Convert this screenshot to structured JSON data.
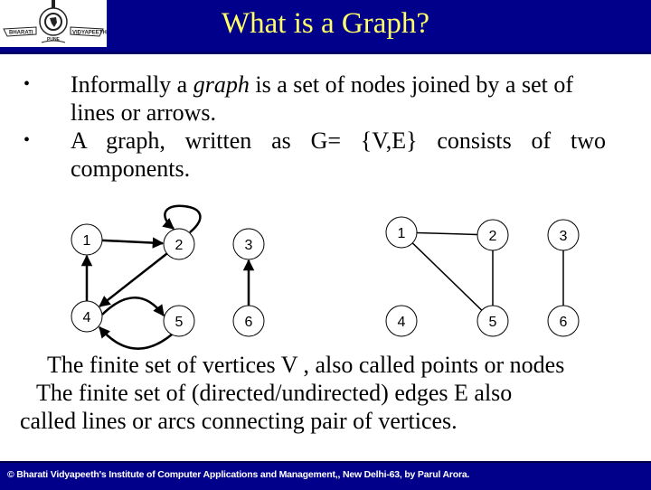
{
  "header": {
    "title": "What is a Graph?",
    "logo": {
      "icon": "institution-logo-icon",
      "left_text": "BHARATI",
      "right_text": "VIDYAPEETH",
      "bottom_text": "PUNE"
    },
    "colors": {
      "background": "#00008b",
      "title": "#ffff66"
    }
  },
  "bullets": [
    {
      "pre": "Informally a ",
      "em": "graph",
      "post": " is a set of nodes joined by a set of lines or arrows."
    },
    {
      "text": "A graph, written as G= {V,E} consists of two components."
    }
  ],
  "directed_graph": {
    "nodes": [
      {
        "id": "1",
        "label": "1"
      },
      {
        "id": "2",
        "label": "2"
      },
      {
        "id": "3",
        "label": "3"
      },
      {
        "id": "4",
        "label": "4"
      },
      {
        "id": "5",
        "label": "5"
      },
      {
        "id": "6",
        "label": "6"
      }
    ],
    "edges": [
      {
        "from": "1",
        "to": "2"
      },
      {
        "from": "2",
        "to": "2"
      },
      {
        "from": "2",
        "to": "4"
      },
      {
        "from": "4",
        "to": "1"
      },
      {
        "from": "4",
        "to": "5"
      },
      {
        "from": "5",
        "to": "4"
      },
      {
        "from": "6",
        "to": "3"
      }
    ]
  },
  "undirected_graph": {
    "nodes": [
      {
        "id": "1",
        "label": "1"
      },
      {
        "id": "2",
        "label": "2"
      },
      {
        "id": "3",
        "label": "3"
      },
      {
        "id": "4",
        "label": "4"
      },
      {
        "id": "5",
        "label": "5"
      },
      {
        "id": "6",
        "label": "6"
      }
    ],
    "edges": [
      {
        "from": "1",
        "to": "2"
      },
      {
        "from": "1",
        "to": "5"
      },
      {
        "from": "2",
        "to": "5"
      },
      {
        "from": "3",
        "to": "6"
      }
    ]
  },
  "description": [
    "The finite set of vertices V , also called points or nodes",
    "The finite set of (directed/undirected) edges E also",
    "called lines or arcs connecting pair of vertices."
  ],
  "footer": {
    "text": "© Bharati Vidyapeeth's Institute of Computer Applications and Management,, New Delhi-63, by Parul Arora."
  }
}
